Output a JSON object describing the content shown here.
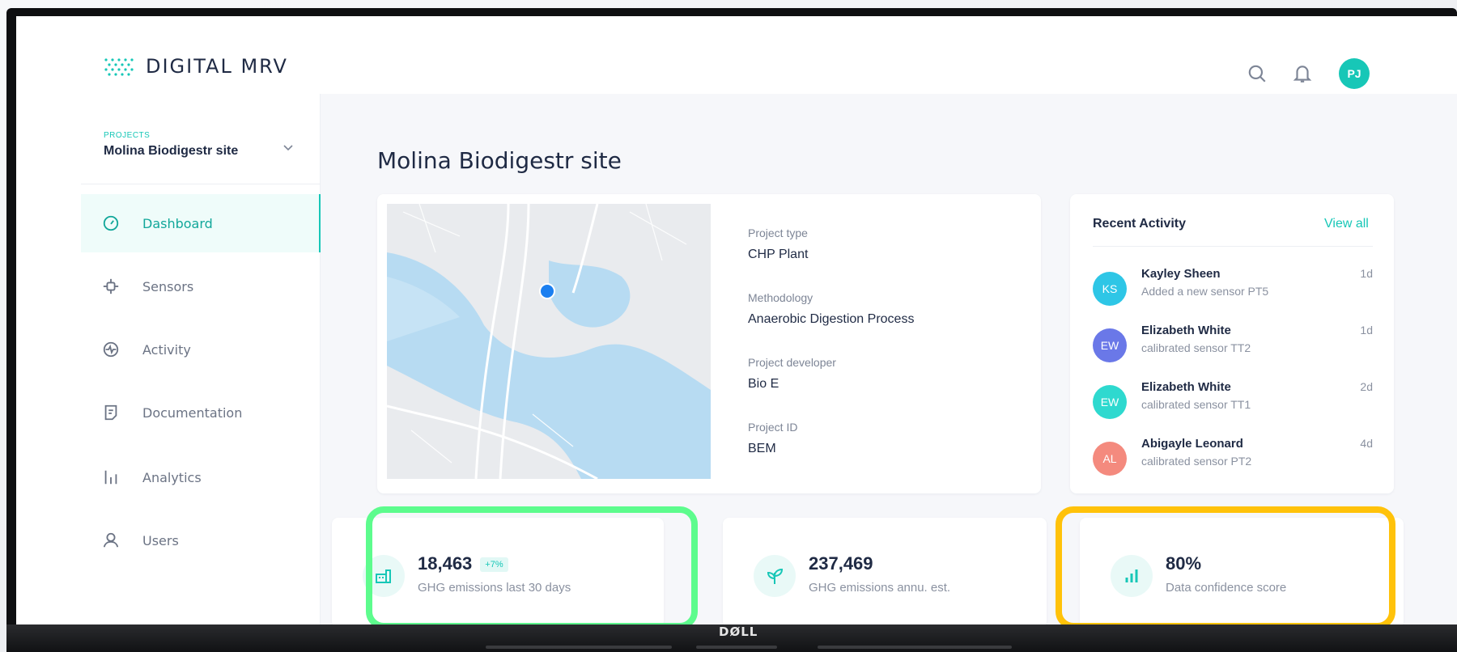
{
  "brand": {
    "name": "DIGITAL MRV",
    "accent": "#17c7b7"
  },
  "header": {
    "avatar_initials": "PJ",
    "search_icon": "search-icon",
    "bell_icon": "bell-icon"
  },
  "sidebar": {
    "project_label": "PROJECTS",
    "project_name": "Molina Biodigestr site",
    "items": [
      {
        "label": "Dashboard",
        "icon": "gauge-icon",
        "active": true
      },
      {
        "label": "Sensors",
        "icon": "sensor-icon",
        "active": false
      },
      {
        "label": "Activity",
        "icon": "activity-icon",
        "active": false
      },
      {
        "label": "Documentation",
        "icon": "document-icon",
        "active": false
      },
      {
        "label": "Analytics",
        "icon": "analytics-icon",
        "active": false
      },
      {
        "label": "Users",
        "icon": "user-icon",
        "active": false
      }
    ]
  },
  "main": {
    "title": "Molina Biodigestr site",
    "details": [
      {
        "label": "Project type",
        "value": "CHP Plant"
      },
      {
        "label": "Methodology",
        "value": "Anaerobic Digestion Process"
      },
      {
        "label": "Project developer",
        "value": "Bio E"
      },
      {
        "label": "Project ID",
        "value": "BEM"
      }
    ],
    "activity": {
      "title": "Recent Activity",
      "view_all": "View all",
      "items": [
        {
          "initials": "KS",
          "name": "Kayley Sheen",
          "desc": "Added a new sensor PT5",
          "time": "1d",
          "color": "#2ec6e6"
        },
        {
          "initials": "EW",
          "name": "Elizabeth White",
          "desc": "calibrated sensor TT2",
          "time": "1d",
          "color": "#6a78e8"
        },
        {
          "initials": "EW",
          "name": "Elizabeth White",
          "desc": "calibrated sensor TT1",
          "time": "2d",
          "color": "#2ed9cf"
        },
        {
          "initials": "AL",
          "name": "Abigayle Leonard",
          "desc": "calibrated sensor PT2",
          "time": "4d",
          "color": "#f48a7e"
        }
      ]
    },
    "stats": [
      {
        "value": "18,463",
        "badge": "+7%",
        "label": "GHG emissions last 30 days",
        "icon": "factory-icon",
        "highlight": "#5dfc8d"
      },
      {
        "value": "237,469",
        "badge": "",
        "label": "GHG emissions annu. est.",
        "icon": "plant-icon",
        "highlight": ""
      },
      {
        "value": "80%",
        "badge": "",
        "label": "Data confidence score",
        "icon": "bar-chart-icon",
        "highlight": "#ffc20a"
      }
    ]
  },
  "monitor": {
    "brand": "DØLL"
  }
}
